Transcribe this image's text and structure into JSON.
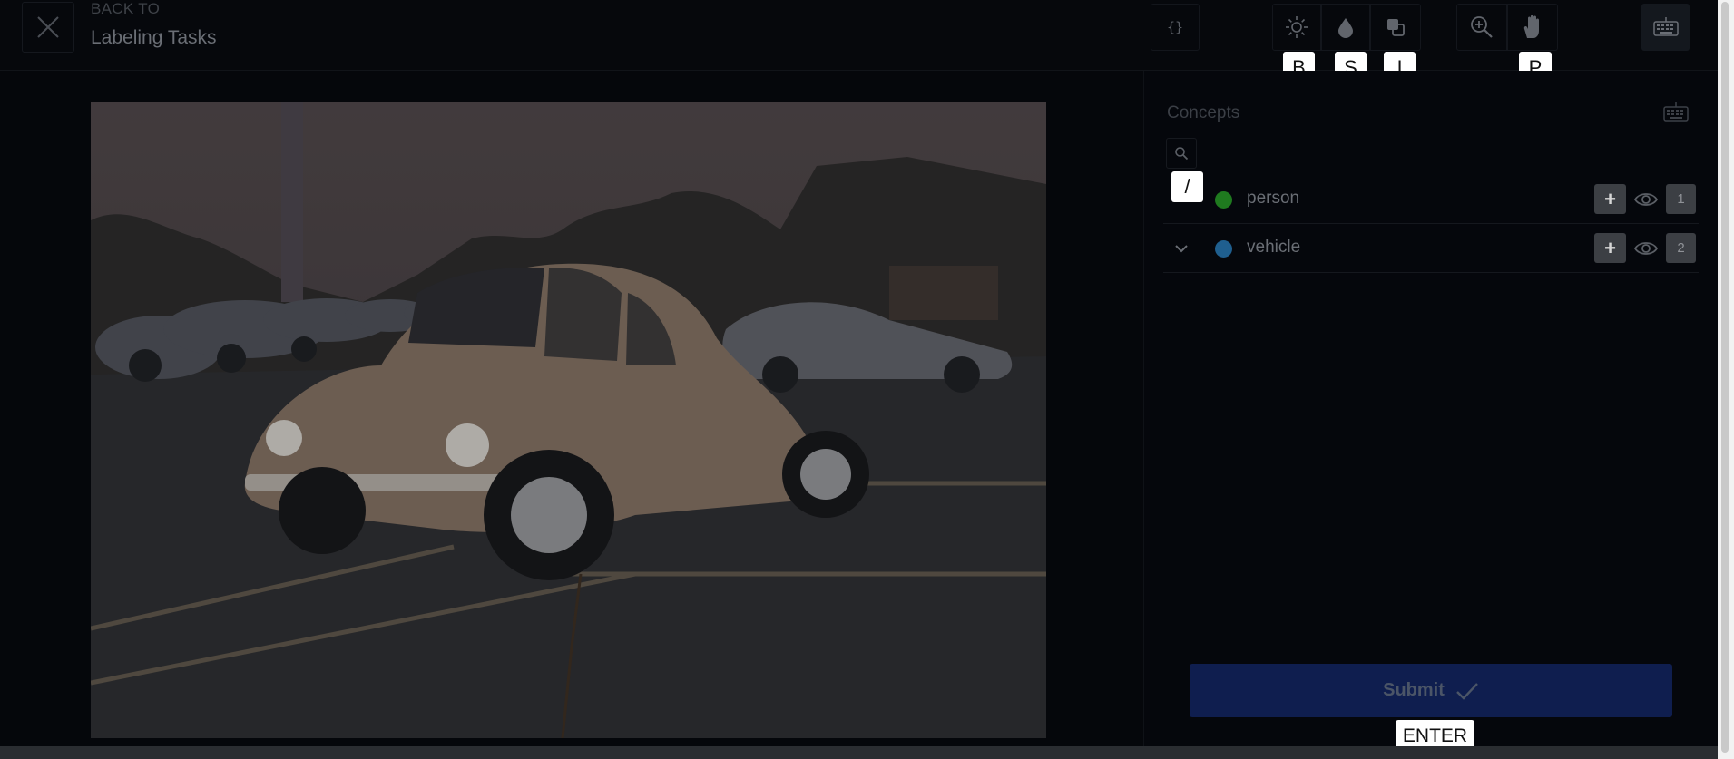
{
  "header": {
    "back_label": "BACK TO",
    "title": "Labeling Tasks",
    "close_icon": "close-icon",
    "json_label": "{}",
    "tools": [
      {
        "name": "brightness",
        "icon": "brightness-icon",
        "hotkey": "B"
      },
      {
        "name": "saturation",
        "icon": "saturation-icon",
        "hotkey": "S"
      },
      {
        "name": "invert",
        "icon": "invert-icon",
        "hotkey": "I"
      },
      {
        "name": "zoom",
        "icon": "zoom-in-icon"
      },
      {
        "name": "pan",
        "icon": "hand-icon",
        "hotkey": "P"
      }
    ],
    "keyboard_icon": "keyboard-icon"
  },
  "panel": {
    "title": "Concepts",
    "search_hotkey": "/",
    "concepts": [
      {
        "label": "person",
        "color": "#1f7a1f",
        "count": "1"
      },
      {
        "label": "vehicle",
        "color": "#1f5f8f",
        "count": "2",
        "collapsible": true
      }
    ],
    "add_label": "+",
    "submit_label": "Submit",
    "submit_hotkey": "ENTER"
  },
  "colors": {
    "background": "#05070b",
    "submit": "#0f1e4f",
    "hint": "#ffffff"
  }
}
